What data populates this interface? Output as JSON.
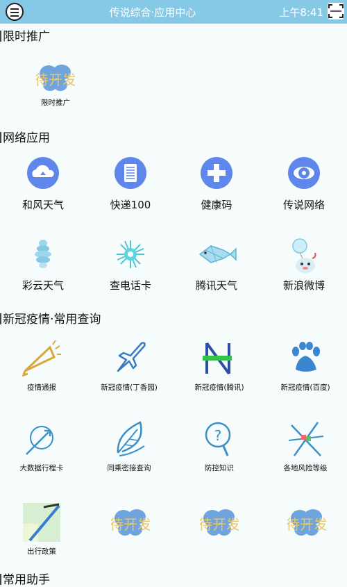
{
  "header": {
    "title": "传说综合·应用中心",
    "time": "上午8:41"
  },
  "sections": {
    "promo": "限时推广",
    "network": "网络应用",
    "covid": "新冠疫情·常用查询",
    "helper": "常用助手"
  },
  "promo_items": [
    "限时推广"
  ],
  "network_items": [
    "和风天气",
    "快递100",
    "健康码",
    "传说网络",
    "彩云天气",
    "查电话卡",
    "腾讯天气",
    "新浪微博"
  ],
  "covid_items": [
    "疫情通报",
    "新冠疫情(丁香园)",
    "新冠疫情(腾讯)",
    "新冠疫情(百度)",
    "大数据行程卡",
    "同乘密接查询",
    "防控知识",
    "各地风险等级",
    "出行政策"
  ],
  "placeholder_text": "待开发",
  "colors": {
    "topbar": "#86c9e6",
    "icon_blue": "#5f86ea",
    "background": "#f6fbfc"
  }
}
